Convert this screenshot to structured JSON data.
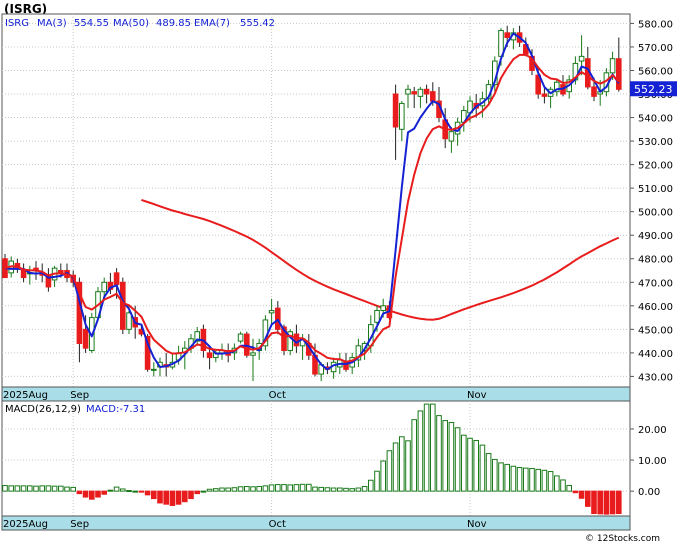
{
  "header": {
    "ticker": "(ISRG)"
  },
  "legend": {
    "symbol": "ISRG",
    "ma3_label": "MA(3)",
    "ma3_value": "554.55",
    "ma50_label": "MA(50)",
    "ma50_value": "489.85",
    "ema7_label": "EMA(7)",
    "ema7_value": "555.42"
  },
  "price_tag": "552.23",
  "macd_legend": {
    "label": "MACD(26,12,9)",
    "value_label": "MACD:-7.31"
  },
  "watermark": "© 12Stocks.com",
  "colors": {
    "up": "#1a7a1a",
    "down": "#e81c1c",
    "ma50": "#e81c1c",
    "ma3": "#1422d4",
    "axis_band": "#a9dde7",
    "price_tag_bg": "#1422d4"
  },
  "chart_data": [
    {
      "type": "candlestick",
      "title": "(ISRG)",
      "yticks": [
        430,
        440,
        450,
        460,
        470,
        480,
        490,
        500,
        510,
        520,
        530,
        540,
        550,
        560,
        570,
        580
      ],
      "ylim": [
        425.5,
        584
      ],
      "x_labels": [
        "2025Aug",
        "Sep",
        "Oct",
        "Nov"
      ],
      "x_label_index": [
        0,
        11,
        43,
        75
      ],
      "n_bars": 100,
      "candles": [
        [
          480,
          482,
          472,
          472
        ],
        [
          474,
          481,
          472,
          479
        ],
        [
          478,
          480,
          474,
          476
        ],
        [
          475,
          478,
          470,
          472
        ],
        [
          474,
          477,
          469,
          474
        ],
        [
          476,
          479,
          471,
          475
        ],
        [
          474,
          478,
          470,
          473
        ],
        [
          473,
          476,
          466,
          468
        ],
        [
          471,
          477,
          468,
          476
        ],
        [
          475,
          478,
          472,
          474
        ],
        [
          475,
          478,
          470,
          472
        ],
        [
          473,
          475,
          468,
          470
        ],
        [
          470,
          472,
          436,
          444
        ],
        [
          450,
          456,
          440,
          442
        ],
        [
          441,
          457,
          440,
          455
        ],
        [
          455,
          468,
          454,
          466
        ],
        [
          466,
          472,
          462,
          470
        ],
        [
          470,
          474,
          465,
          467
        ],
        [
          474,
          476,
          463,
          469
        ],
        [
          470,
          472,
          448,
          450
        ],
        [
          450,
          460,
          448,
          457
        ],
        [
          455,
          460,
          446,
          451
        ],
        [
          450,
          452,
          447,
          448
        ],
        [
          447,
          448,
          432,
          433
        ],
        [
          433,
          436,
          430,
          433
        ],
        [
          434,
          438,
          430,
          436
        ],
        [
          435,
          440,
          430,
          434
        ],
        [
          434,
          440,
          433,
          436
        ],
        [
          437,
          443,
          435,
          440
        ],
        [
          440,
          445,
          433,
          442
        ],
        [
          442,
          448,
          440,
          446
        ],
        [
          445,
          451,
          443,
          449
        ],
        [
          450,
          452,
          438,
          441
        ],
        [
          440,
          443,
          433,
          438
        ],
        [
          438,
          441,
          436,
          440
        ],
        [
          440,
          444,
          437,
          441
        ],
        [
          441,
          444,
          436,
          439
        ],
        [
          440,
          444,
          437,
          442
        ],
        [
          445,
          449,
          444,
          448
        ],
        [
          448,
          449,
          438,
          439
        ],
        [
          439,
          446,
          428,
          440
        ],
        [
          441,
          446,
          437,
          444
        ],
        [
          443,
          456,
          441,
          454
        ],
        [
          457,
          463,
          452,
          458
        ],
        [
          459,
          462,
          448,
          450
        ],
        [
          451,
          452,
          439,
          441
        ],
        [
          441,
          450,
          439,
          449
        ],
        [
          448,
          452,
          440,
          443
        ],
        [
          443,
          448,
          437,
          446
        ],
        [
          444,
          448,
          437,
          439
        ],
        [
          439,
          444,
          430,
          431
        ],
        [
          431,
          436,
          428,
          435
        ],
        [
          434,
          436,
          431,
          433
        ],
        [
          432,
          438,
          429,
          436
        ],
        [
          434,
          440,
          431,
          437
        ],
        [
          436,
          440,
          432,
          433
        ],
        [
          434,
          440,
          431,
          438
        ],
        [
          437,
          446,
          434,
          443
        ],
        [
          441,
          445,
          437,
          444
        ],
        [
          443,
          456,
          440,
          452
        ],
        [
          453,
          460,
          449,
          458
        ],
        [
          458,
          463,
          455,
          460
        ],
        [
          460,
          462,
          454,
          455
        ],
        [
          550,
          554,
          522,
          536
        ],
        [
          535,
          547,
          530,
          546
        ],
        [
          550,
          554,
          544,
          552
        ],
        [
          551,
          553,
          544,
          550
        ],
        [
          549,
          553,
          544,
          552
        ],
        [
          552,
          554,
          546,
          550
        ],
        [
          551,
          555,
          545,
          547
        ],
        [
          547,
          553,
          538,
          540
        ],
        [
          539,
          544,
          527,
          531
        ],
        [
          530,
          536,
          525,
          534
        ],
        [
          533,
          540,
          528,
          538
        ],
        [
          538,
          545,
          534,
          543
        ],
        [
          542,
          549,
          538,
          547
        ],
        [
          546,
          550,
          540,
          544
        ],
        [
          545,
          551,
          540,
          548
        ],
        [
          548,
          556,
          545,
          554
        ],
        [
          554,
          566,
          551,
          564
        ],
        [
          566,
          578,
          562,
          577
        ],
        [
          576,
          579,
          570,
          574
        ],
        [
          573,
          578,
          569,
          576
        ],
        [
          576,
          579,
          570,
          572
        ],
        [
          571,
          574,
          566,
          567
        ],
        [
          566,
          569,
          558,
          560
        ],
        [
          558,
          561,
          548,
          550
        ],
        [
          550,
          553,
          546,
          549
        ],
        [
          549,
          553,
          544,
          552
        ],
        [
          551,
          556,
          549,
          555
        ],
        [
          554,
          558,
          549,
          550
        ],
        [
          551,
          558,
          548,
          556
        ],
        [
          556,
          566,
          554,
          563
        ],
        [
          564,
          575,
          558,
          566
        ],
        [
          565,
          570,
          552,
          553
        ],
        [
          553,
          557,
          547,
          549
        ],
        [
          550,
          556,
          545,
          551
        ],
        [
          551,
          561,
          549,
          559
        ],
        [
          559,
          568,
          556,
          565
        ],
        [
          565,
          574,
          551,
          552
        ]
      ],
      "series": [
        {
          "name": "MA(50)",
          "values": [
            505,
            504.1,
            503.2,
            502.3,
            501.4,
            500.5,
            499.8,
            499,
            498.3,
            497.6,
            496.9,
            496,
            495,
            494,
            492.9,
            491.8,
            490.6,
            489.4,
            488,
            486.4,
            484.7,
            482.8,
            480.9,
            479,
            477.1,
            475.3,
            473.6,
            472,
            470.6,
            469.3,
            468.1,
            467,
            466,
            465,
            464,
            463,
            462,
            461,
            460,
            459,
            458,
            457.1,
            456.3,
            455.6,
            455,
            454.5,
            454.2,
            454.1,
            454.5,
            455.4,
            456.5,
            457.5,
            458.5,
            459.4,
            460.3,
            461.2,
            462,
            462.8,
            463.6,
            464.5,
            465.4,
            466.4,
            467.5,
            468.6,
            469.9,
            471.2,
            472.7,
            474.2,
            475.9,
            477.6,
            479.4,
            481,
            482.4,
            483.9,
            485.3,
            486.5,
            487.8,
            489
          ]
        },
        {
          "name": "MA(3)",
          "values": [
            476,
            475.7,
            475.7,
            475.7,
            474,
            473.7,
            474,
            472,
            472.3,
            472.7,
            474,
            472,
            462,
            452,
            447,
            454.3,
            463.7,
            467.7,
            468.7,
            462,
            458.7,
            452.7,
            452,
            444,
            438,
            434,
            434.3,
            435.3,
            436.7,
            439.3,
            442.7,
            445.7,
            445.3,
            442.7,
            439.7,
            439.7,
            440,
            440.7,
            443,
            443,
            442.3,
            441,
            446,
            452,
            454,
            449.7,
            446.7,
            444.3,
            446,
            442.7,
            438.7,
            435,
            433,
            434.7,
            435.3,
            435.3,
            436,
            438,
            441.7,
            446.3,
            451.3,
            456.7,
            457.7,
            483.7,
            510.3,
            533.7,
            535.3,
            540,
            543.7,
            547,
            545.7,
            539.3,
            535,
            534.3,
            537.7,
            541.7,
            544.7,
            546.3,
            548.7,
            555.3,
            565,
            571.7,
            575.7,
            574,
            571.7,
            566.3,
            559,
            553,
            550.3,
            552,
            552.3,
            553.7,
            556.3,
            561.7,
            560.7,
            556,
            551,
            553,
            558.3,
            554.6
          ]
        },
        {
          "name": "EMA(7)",
          "values": [
            476,
            476.8,
            476.6,
            475.4,
            475.1,
            475,
            474.5,
            472.9,
            473.7,
            473.8,
            473.3,
            472.5,
            465.4,
            459.5,
            458.4,
            460.3,
            462.7,
            463.8,
            465.1,
            461.3,
            460.2,
            457.9,
            455.4,
            449.8,
            445.6,
            443.2,
            440.9,
            439.7,
            439.8,
            440.3,
            441.8,
            443.6,
            443,
            441.7,
            441.3,
            441.2,
            440.6,
            441,
            442.8,
            441.8,
            441.4,
            442,
            445,
            448.3,
            448.7,
            446.8,
            447.3,
            446.3,
            446.2,
            444.4,
            441.1,
            439.6,
            437.9,
            437.4,
            437.3,
            436.2,
            436.7,
            438.3,
            439.7,
            442.8,
            446.6,
            450,
            451.3,
            472.5,
            488.4,
            504.3,
            515.7,
            524.8,
            531.1,
            535.1,
            536.3,
            535,
            534.8,
            535.6,
            537.5,
            539.8,
            540.9,
            542.7,
            545.5,
            550.1,
            556.8,
            561.1,
            564.8,
            566.6,
            566.7,
            565,
            561.3,
            558.2,
            556.6,
            556.2,
            554.7,
            555,
            557,
            559.3,
            557.7,
            555.5,
            554.4,
            555.6,
            558,
            555.2
          ]
        }
      ],
      "macd": {
        "label": "MACD(26,12,9)",
        "yticks": [
          0,
          10,
          20
        ],
        "ylim": [
          -8,
          29
        ],
        "histogram": [
          1.8,
          1.7,
          1.7,
          1.7,
          1.7,
          1.6,
          1.7,
          1.7,
          1.6,
          1.6,
          1.3,
          1.2,
          -0.8,
          -1.9,
          -2.6,
          -1.9,
          -1,
          0.3,
          1.3,
          0.7,
          0.2,
          0,
          -0.3,
          -1.2,
          -2.4,
          -3.8,
          -4.2,
          -4.6,
          -4.2,
          -3.4,
          -2.4,
          -0.8,
          0,
          0.6,
          0.8,
          1,
          1,
          1.1,
          1.4,
          1.5,
          1.4,
          1.5,
          1.7,
          2,
          2.1,
          2.1,
          2,
          2.1,
          2.2,
          2.2,
          1.3,
          1.2,
          1.1,
          1,
          1,
          0.9,
          0.8,
          1,
          1.5,
          3.5,
          6.4,
          9.7,
          13,
          15.5,
          17.5,
          16.2,
          23,
          25.8,
          28,
          28,
          24.3,
          22.7,
          22.1,
          20.4,
          18,
          17,
          16.3,
          14.8,
          12.1,
          10.2,
          9.1,
          8.6,
          8,
          7.6,
          7.4,
          7.3,
          7,
          6.7,
          6.3,
          4.9,
          3.6,
          1.8,
          -0.5,
          -2.3,
          -4.9,
          -7.2,
          -7.3,
          -7.4,
          -7.3,
          -7.2
        ]
      }
    }
  ]
}
